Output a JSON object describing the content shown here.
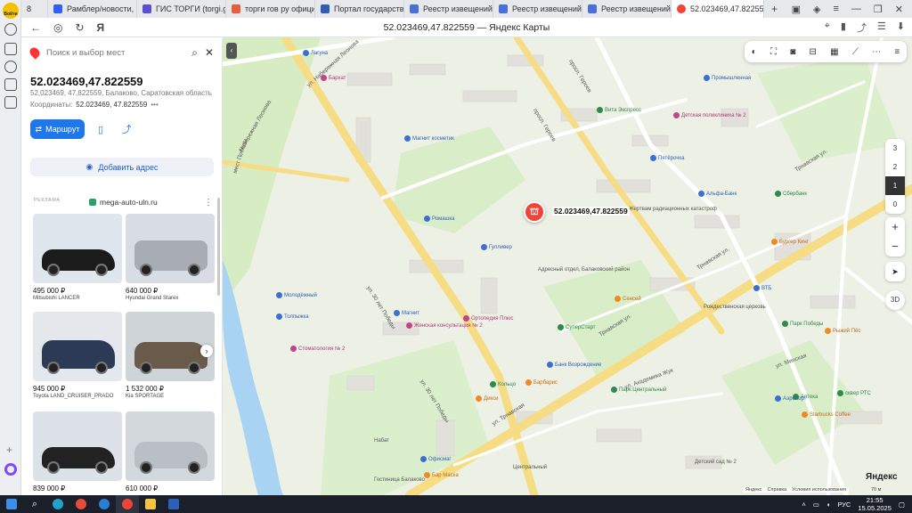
{
  "browser": {
    "tabs_count": "8",
    "tabs": [
      {
        "label": "Рамблер/новости, почт",
        "color": "#315efb"
      },
      {
        "label": "ГИС ТОРГИ (torgi.gov.r",
        "color": "#5a4fcf"
      },
      {
        "label": "торги гов ру официаль",
        "color": "#e85d3c"
      },
      {
        "label": "Портал государственн",
        "color": "#2c5fb5"
      },
      {
        "label": "Реестр извещений",
        "color": "#4a6fd8"
      },
      {
        "label": "Реестр извещений",
        "color": "#4a6fd8"
      },
      {
        "label": "Реестр извещений",
        "color": "#4a6fd8"
      },
      {
        "label": "52.023469,47.822559",
        "color": "#f04438",
        "active": true
      }
    ],
    "page_title": "52.023469,47.822559 — Яндекс Карты",
    "avatar_text": "Войти"
  },
  "panel": {
    "search_placeholder": "Поиск и выбор мест",
    "title": "52.023469,47.822559",
    "subtitle": "52,023469, 47,822559, Балаково, Саратовская область",
    "coords_label": "Координаты:",
    "coords_value": "52.023469, 47.822559",
    "route_label": "Маршрут",
    "add_address_label": "Добавить адрес",
    "ad_label": "РЕКЛАМА",
    "ad_site": "mega-auto-uln.ru",
    "cars": [
      {
        "price": "495 000 ₽",
        "name": "Mitsubishi LANCER",
        "color": "#1b1b1b",
        "bg": "#dfe6ee"
      },
      {
        "price": "640 000 ₽",
        "name": "Hyundai Grand Starex",
        "color": "#a8adb3",
        "bg": "#d8dde3"
      },
      {
        "price": "945 000 ₽",
        "name": "Toyota LAND_CRUISER_PRADO",
        "color": "#2c3a56",
        "bg": "#e4e7ec"
      },
      {
        "price": "1 532 000 ₽",
        "name": "Kia SPORTAGE",
        "color": "#6a5a4a",
        "bg": "#cfd4d8"
      },
      {
        "price": "839 000 ₽",
        "name": "",
        "color": "#222",
        "bg": "#dde2e8"
      },
      {
        "price": "610 000 ₽",
        "name": "",
        "color": "#b9bfc5",
        "bg": "#d3d8dc"
      }
    ]
  },
  "map": {
    "marker_label": "52.023469,47.822559",
    "floors": [
      "3",
      "2",
      "1",
      "0"
    ],
    "selected_floor": "1",
    "zoom_in": "+",
    "zoom_out": "−",
    "btn_3d": "3D",
    "logo": "Яндекс",
    "bottom_links": [
      "Яндекс",
      "Справка",
      "Условия использования"
    ],
    "scale": "70 м",
    "streets": [
      "ул. Набережная Леонова",
      "Набережная Леонова",
      "просп. Героев",
      "ул. 30 лет Победы",
      "Трнавская ул.",
      "ул. Трнавская",
      "мест Победы",
      "ул. Академика Жук",
      "ул. Минская"
    ],
    "places": [
      "Лагуна",
      "Бархат",
      "Магнит косметик",
      "Вита Экспресс",
      "Детская поликлиника № 2",
      "Промышленная",
      "Пятёрочка",
      "Альфа-Банк",
      "Сбербанк",
      "Жертвам радиационных катастроф",
      "Ромашка",
      "Гулливер",
      "Адресный отдел, Балаковский район",
      "Магнит",
      "Женская консультация № 2",
      "Ортопедия Плюс",
      "Сенсей",
      "Рождественская церковь",
      "СуперСтарт",
      "Банк Возрождение",
      "Бургер Кинг",
      "ВТБ",
      "Молодёжный",
      "Толпыжка",
      "Кольцо",
      "Барбарис",
      "Дикси",
      "Парк Центральный",
      "Офисмаг",
      "Бар Маска",
      "Гостиница Балаково",
      "Центральный",
      "Детский сад № 2",
      "Аптека",
      "Набат",
      "Стоматология № 2",
      "Парк Победы",
      "Рыжий Пёс",
      "Аэропорт",
      "сквер РТС",
      "Starbucks Coffee"
    ]
  },
  "taskbar": {
    "lang": "РУС",
    "time": "21:55",
    "date": "15.05.2025"
  }
}
